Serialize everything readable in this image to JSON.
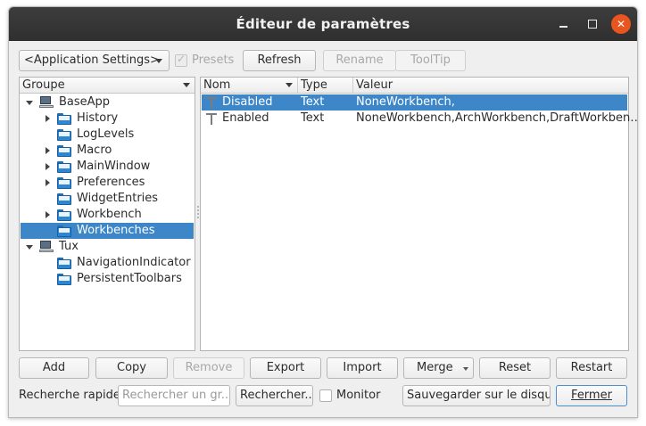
{
  "window": {
    "title": "Éditeur de paramètres",
    "min_glyph": "",
    "close_glyph": "✕"
  },
  "toolbar": {
    "config_combo": "<Application Settings>",
    "presets_label": "Presets",
    "presets_checked": true,
    "refresh_label": "Refresh",
    "rename_label": "Rename",
    "tooltip_label": "ToolTip"
  },
  "tree": {
    "header": "Groupe",
    "items": [
      {
        "label": "BaseApp",
        "level": 0,
        "expander": "expanded",
        "icon": "computer-icon"
      },
      {
        "label": "History",
        "level": 1,
        "expander": "collapsed",
        "icon": "folder-icon"
      },
      {
        "label": "LogLevels",
        "level": 1,
        "expander": "none",
        "icon": "folder-icon"
      },
      {
        "label": "Macro",
        "level": 1,
        "expander": "collapsed",
        "icon": "folder-icon"
      },
      {
        "label": "MainWindow",
        "level": 1,
        "expander": "collapsed",
        "icon": "folder-icon"
      },
      {
        "label": "Preferences",
        "level": 1,
        "expander": "collapsed",
        "icon": "folder-icon"
      },
      {
        "label": "WidgetEntries",
        "level": 1,
        "expander": "none",
        "icon": "folder-icon"
      },
      {
        "label": "Workbench",
        "level": 1,
        "expander": "collapsed",
        "icon": "folder-icon"
      },
      {
        "label": "Workbenches",
        "level": 1,
        "expander": "none",
        "icon": "folder-icon",
        "selected": true
      },
      {
        "label": "Tux",
        "level": 0,
        "expander": "expanded",
        "icon": "computer-icon"
      },
      {
        "label": "NavigationIndicator",
        "level": 1,
        "expander": "none",
        "icon": "folder-icon"
      },
      {
        "label": "PersistentToolbars",
        "level": 1,
        "expander": "none",
        "icon": "folder-icon"
      }
    ]
  },
  "table": {
    "columns": [
      "Nom",
      "Type",
      "Valeur"
    ],
    "rows": [
      {
        "name": "Disabled",
        "type": "Text",
        "value": "NoneWorkbench,",
        "selected": true,
        "icon": "text-icon"
      },
      {
        "name": "Enabled",
        "type": "Text",
        "value": "NoneWorkbench,ArchWorkbench,DraftWorkben…",
        "icon": "text-icon"
      }
    ]
  },
  "buttons": {
    "add": "Add",
    "copy": "Copy",
    "remove": "Remove",
    "export": "Export",
    "import": "Import",
    "merge": "Merge",
    "reset": "Reset",
    "restart": "Restart"
  },
  "search": {
    "label": "Recherche rapide",
    "placeholder": "Rechercher un gr...",
    "button": "Rechercher...",
    "monitor_label": "Monitor"
  },
  "footer": {
    "save": "Sauvegarder sur le disque",
    "close": "Fermer"
  },
  "colors": {
    "selection": "#3d87c9",
    "titlebar": "#333333",
    "close_button": "#e9541f",
    "folder": "#2d86d3"
  }
}
